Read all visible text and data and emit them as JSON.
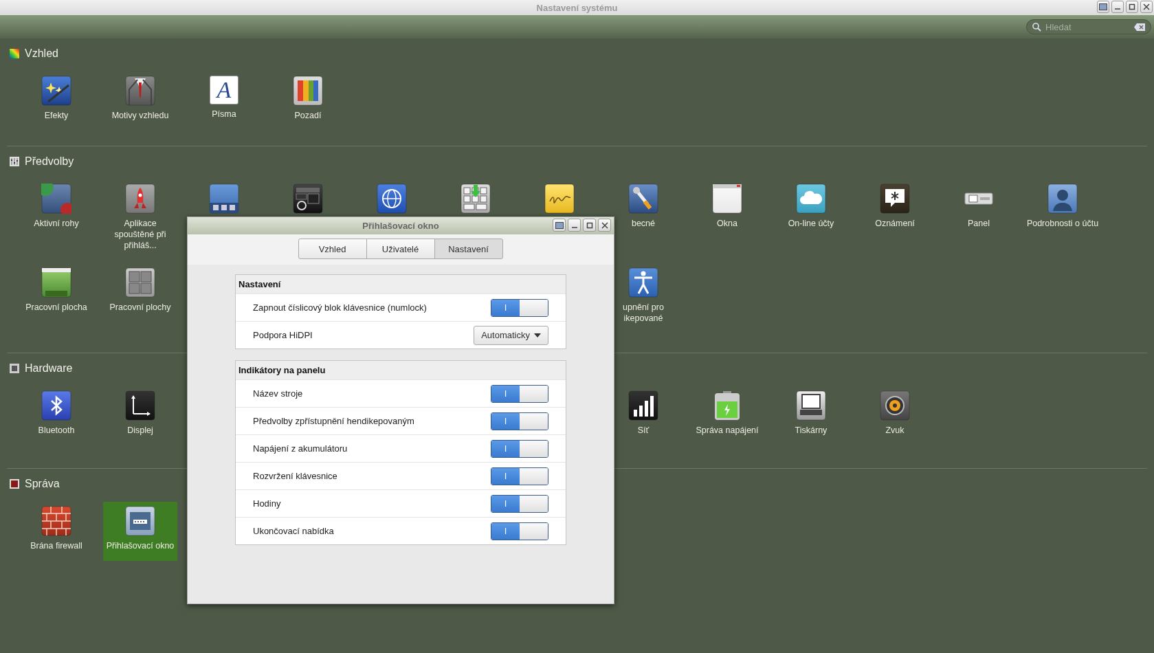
{
  "window": {
    "title": "Nastavení systému"
  },
  "search": {
    "placeholder": "Hledat"
  },
  "sections": [
    {
      "title": "Vzhled",
      "items": [
        {
          "label": "Efekty",
          "selected": false
        },
        {
          "label": "Motivy vzhledu",
          "selected": false
        },
        {
          "label": "Písma",
          "glyph": "A",
          "selected": false
        },
        {
          "label": "Pozadí",
          "selected": false
        }
      ]
    },
    {
      "title": "Předvolby",
      "items": [
        {
          "label": "Aktivní rohy",
          "selected": false
        },
        {
          "label": "Aplikace spouštěné při přihláš...",
          "selected": false
        },
        {
          "selected": false
        },
        {
          "selected": false
        },
        {
          "selected": false
        },
        {
          "selected": false
        },
        {
          "selected": false
        },
        {
          "label": "becné",
          "selected": false
        },
        {
          "label": "Okna",
          "selected": false
        },
        {
          "label": "On-line účty",
          "selected": false
        },
        {
          "label": "Oznámení",
          "selected": false
        },
        {
          "label": "Panel",
          "selected": false
        },
        {
          "label": "Podrobnosti o účtu",
          "selected": false
        },
        {
          "label": "Pracovní plocha",
          "selected": false
        },
        {
          "label": "Pracovní plochy",
          "selected": false
        },
        {
          "label": "upnění pro ikepované",
          "selected": false
        }
      ]
    },
    {
      "title": "Hardware",
      "items": [
        {
          "label": "Bluetooth",
          "selected": false
        },
        {
          "label": "Displej",
          "selected": false
        },
        {
          "label": "Síť",
          "selected": false
        },
        {
          "label": "Správa napájení",
          "selected": false
        },
        {
          "label": "Tiskárny",
          "selected": false
        },
        {
          "label": "Zvuk",
          "selected": false
        }
      ]
    },
    {
      "title": "Správa",
      "items": [
        {
          "label": "Brána firewall",
          "selected": false
        },
        {
          "label": "Přihlašovací okno",
          "selected": true
        }
      ]
    }
  ],
  "dialog": {
    "title": "Přihlašovací okno",
    "tabs": [
      {
        "label": "Vzhled",
        "selected": false
      },
      {
        "label": "Uživatelé",
        "selected": false
      },
      {
        "label": "Nastavení",
        "selected": true
      }
    ],
    "groups": [
      {
        "title": "Nastavení",
        "rows": [
          {
            "kind": "switch",
            "label": "Zapnout číslicový blok klávesnice (numlock)",
            "on": true,
            "glyph": "I"
          },
          {
            "kind": "dropdown",
            "label": "Podpora HiDPI",
            "value": "Automaticky"
          }
        ]
      },
      {
        "title": "Indikátory na panelu",
        "rows": [
          {
            "kind": "switch",
            "label": "Název stroje",
            "on": true,
            "glyph": "I"
          },
          {
            "kind": "switch",
            "label": "Předvolby zpřístupnění hendikepovaným",
            "on": true,
            "glyph": "I"
          },
          {
            "kind": "switch",
            "label": "Napájení z akumulátoru",
            "on": true,
            "glyph": "I"
          },
          {
            "kind": "switch",
            "label": "Rozvržení klávesnice",
            "on": true,
            "glyph": "I"
          },
          {
            "kind": "switch",
            "label": "Hodiny",
            "on": true,
            "glyph": "I"
          },
          {
            "kind": "switch",
            "label": "Ukončovací nabídka",
            "on": true,
            "glyph": "I"
          }
        ]
      }
    ]
  }
}
